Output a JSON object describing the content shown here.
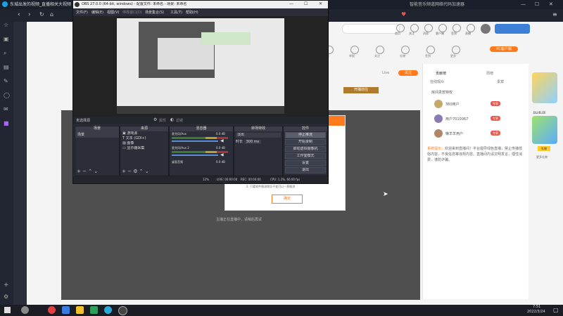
{
  "browser": {
    "tab_title": "东城出发的视频_直播相关大视频",
    "window_right_text": "智能音乐频道网络代码加速器"
  },
  "header_nav": [
    "首页",
    "关注",
    "消息",
    "客户端",
    "签到",
    "直播"
  ],
  "stream_topbar": [
    "分享",
    "举报",
    "关注",
    "礼物",
    "签到",
    "更多"
  ],
  "stream": {
    "room_badge": "PC客户端",
    "live_tag": "Live",
    "follow_btn": "关注",
    "banner": "开播前往",
    "overlay_text": "主播正在直播中，请稍后再试"
  },
  "chat": {
    "rank_title": "贡献榜",
    "rank_tab": "周榜",
    "tab_online": "在线观众",
    "tab_fans": "贵宾",
    "list_title": "房间贵宾特权",
    "users": [
      {
        "name": "360用户",
        "badge": "专享"
      },
      {
        "name": "用户7010067",
        "badge": "专享"
      },
      {
        "name": "懒羊羊用户",
        "badge": "专享"
      }
    ],
    "system_label": "系统提示：",
    "system_msg": "欢迎来到直播间！平台倡导绿色直播，禁止传播低俗内容、不良信息等违规内容。直播间内请文明发言，理性消费，谨防诈骗。"
  },
  "promo": {
    "label_blue": "BLUELEE",
    "label_gift": "礼物",
    "label_more": "更多礼物"
  },
  "obs": {
    "title": "OBS 27.0.0 (64-bit, windows) - 配置文件: 未命名 - 场景: 未命名",
    "menu": [
      "文件(F)",
      "编辑(E)",
      "视图(V)",
      "停靠窗口(D)",
      "场景集合(S)",
      "工具(T)",
      "帮助(H)"
    ],
    "filter_bar": [
      "未选择源",
      "属性",
      "滤镜"
    ],
    "docks": {
      "scenes": "场景",
      "sources": "来源",
      "mixer": "混音器",
      "transitions": "转场特效",
      "controls": "控件"
    },
    "scene_items": [
      "场景"
    ],
    "source_items": [
      "游戏源",
      "文本 (GDI+)",
      "图像",
      "显示器采集"
    ],
    "mixer_tracks": [
      {
        "name": "麦克风/Aux",
        "db": "0.0 dB",
        "level": 0.72
      },
      {
        "name": "麦克风/Aux 2",
        "db": "0.0 dB",
        "level": 0.55
      },
      {
        "name": "桌面音频",
        "db": "0.0 dB",
        "level": 0.6
      }
    ],
    "transition": {
      "type": "淡出",
      "duration_label": "时长",
      "duration": "300 ms"
    },
    "controls": [
      "停止推流",
      "开始录制",
      "启动虚拟摄像机",
      "工作室模式",
      "设置",
      "退出"
    ],
    "status": {
      "live": "LIVE: 00:00:00",
      "rec": "REC: 00:00:00",
      "cpu": "CPU: 1.2%, 60.00 fps",
      "bitrate": "12%"
    }
  },
  "dialog": {
    "line1": "1. 若开启直播功能请在本地软件里进行设置",
    "line2": "2. 只要软件推流地址不变可以一直推流",
    "ok": "确定"
  },
  "taskbar": {
    "time": "7:51",
    "date": "2022/3/24"
  },
  "colors": {
    "accent": "#ff7a1a",
    "obs_bg": "#2b2e38",
    "taskbar": "#1a1d24",
    "stream_bg": "#4f4f4f"
  }
}
